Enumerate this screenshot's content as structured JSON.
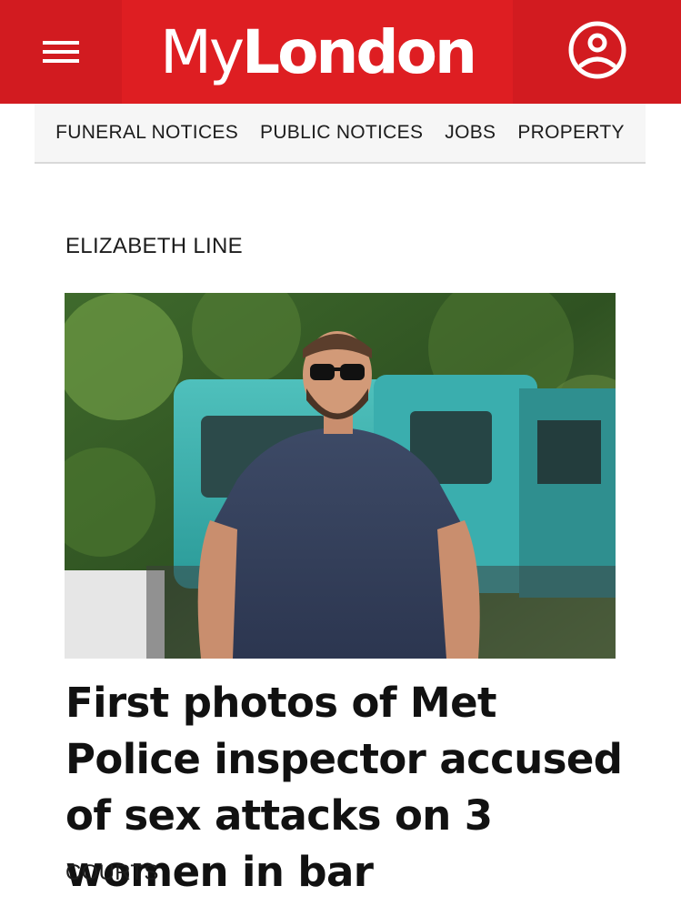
{
  "header": {
    "brand_my": "My",
    "brand_london": "London",
    "menu_icon": "hamburger-menu-icon",
    "account_icon": "user-account-icon",
    "brand_color": "#de1e22"
  },
  "subnav": {
    "items": [
      {
        "label": "FUNERAL NOTICES"
      },
      {
        "label": "PUBLIC NOTICES"
      },
      {
        "label": "JOBS"
      },
      {
        "label": "PROPERTY"
      }
    ]
  },
  "article": {
    "section": "ELIZABETH LINE",
    "headline": "First photos of Met Police inspector accused of sex attacks on 3 women in bar",
    "category": "COURTS"
  }
}
